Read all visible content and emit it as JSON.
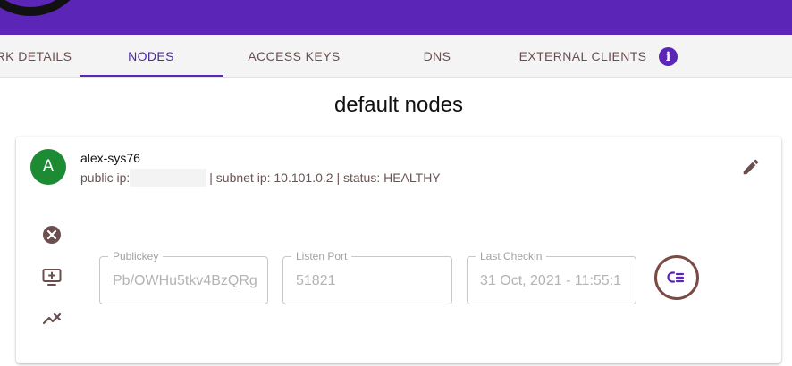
{
  "header": {
    "tabs": [
      {
        "label": "RK DETAILS",
        "active": false
      },
      {
        "label": "NODES",
        "active": true
      },
      {
        "label": "ACCESS KEYS",
        "active": false
      },
      {
        "label": "DNS",
        "active": false
      },
      {
        "label": "EXTERNAL CLIENTS",
        "active": false
      }
    ],
    "info_icon": "info-icon"
  },
  "page": {
    "title": "default nodes"
  },
  "node": {
    "avatar_letter": "A",
    "name": "alex-sys76",
    "public_ip_label": "public ip:",
    "public_ip_value": "",
    "subnet_text": "| subnet ip: 10.101.0.2 | status: HEALTHY",
    "fields": {
      "publickey": {
        "label": "Publickey",
        "value": "Pb/OWHu5tkv4BzQRg"
      },
      "listen_port": {
        "label": "Listen Port",
        "value": "51821"
      },
      "last_checkin": {
        "label": "Last Checkin",
        "value": "31 Oct, 2021 - 11:55:1"
      }
    },
    "icons": [
      "cancel-circle-icon",
      "add-to-queue-icon",
      "trending-down-icon",
      "edit-pencil-icon",
      "list-view-icon"
    ]
  },
  "colors": {
    "primary": "#5b25b7",
    "avatar": "#1d8a34",
    "tab_text": "#6b4f4f",
    "action_ring": "#7a4a44"
  }
}
